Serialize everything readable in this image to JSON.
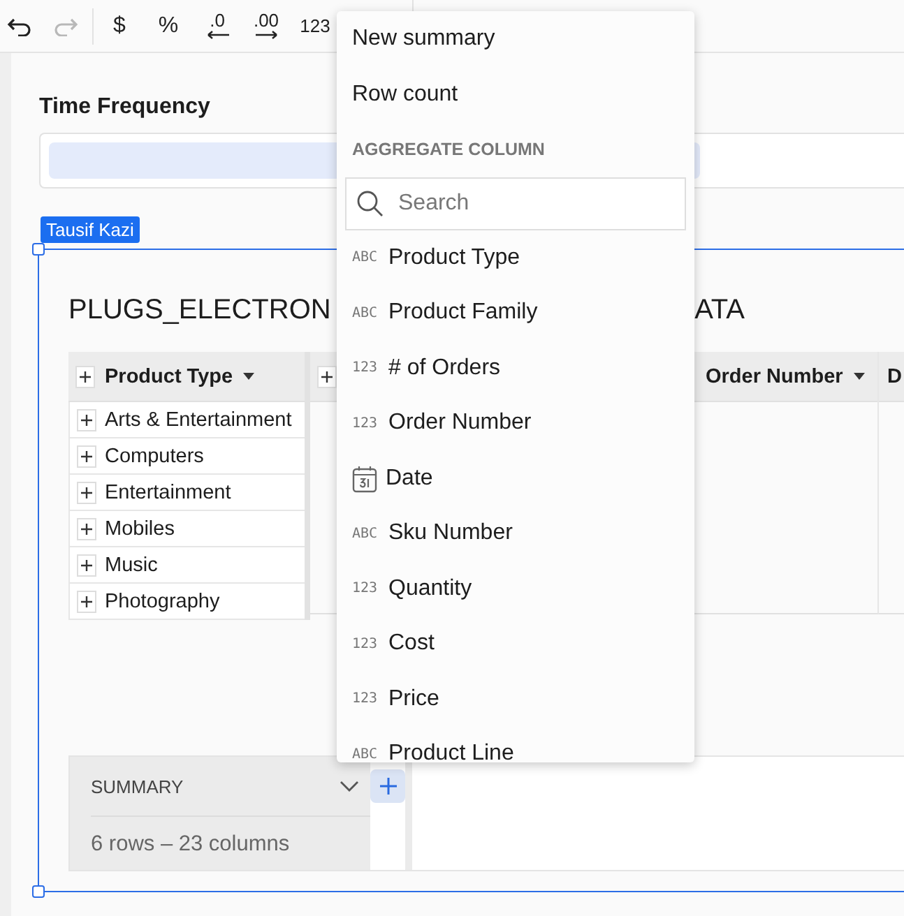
{
  "toolbar": [
    {
      "kind": "undo",
      "disabled": false
    },
    {
      "kind": "redo",
      "disabled": true
    },
    {
      "kind": "text",
      "label": "$",
      "disabled": false
    },
    {
      "kind": "text",
      "label": "%",
      "disabled": false
    },
    {
      "kind": "decimal-less",
      "label": ".0",
      "disabled": false
    },
    {
      "kind": "decimal-more",
      "label": ".00",
      "disabled": false
    },
    {
      "kind": "text",
      "label": "123",
      "disabled": false
    }
  ],
  "control": {
    "label": "Time Frequency"
  },
  "selection_tag": "Tausif Kazi",
  "element": {
    "title_start": "PLUGS_ELECTRON",
    "title_end": "ATA",
    "row_header": "Product Type",
    "rows": [
      "Arts & Entertainment",
      "Computers",
      "Entertainment",
      "Mobiles",
      "Music",
      "Photography"
    ],
    "column_headers": [
      "Order Number",
      "D"
    ],
    "summary": {
      "label": "SUMMARY",
      "info": "6 rows – 23 columns"
    }
  },
  "menu": {
    "items": [
      "New summary",
      "Row count"
    ],
    "section": "AGGREGATE COLUMN",
    "search": {
      "placeholder": "Search"
    },
    "columns": [
      {
        "kind": "text",
        "badge": "ABC",
        "label": "Product Type"
      },
      {
        "kind": "text",
        "badge": "ABC",
        "label": "Product Family"
      },
      {
        "kind": "text",
        "badge": "123",
        "label": "# of Orders"
      },
      {
        "kind": "text",
        "badge": "123",
        "label": "Order Number"
      },
      {
        "kind": "date",
        "label": "Date"
      },
      {
        "kind": "text",
        "badge": "ABC",
        "label": "Sku Number"
      },
      {
        "kind": "text",
        "badge": "123",
        "label": "Quantity"
      },
      {
        "kind": "text",
        "badge": "123",
        "label": "Cost"
      },
      {
        "kind": "text",
        "badge": "123",
        "label": "Price"
      },
      {
        "kind": "text",
        "badge": "ABC",
        "label": "Product Line"
      }
    ]
  }
}
